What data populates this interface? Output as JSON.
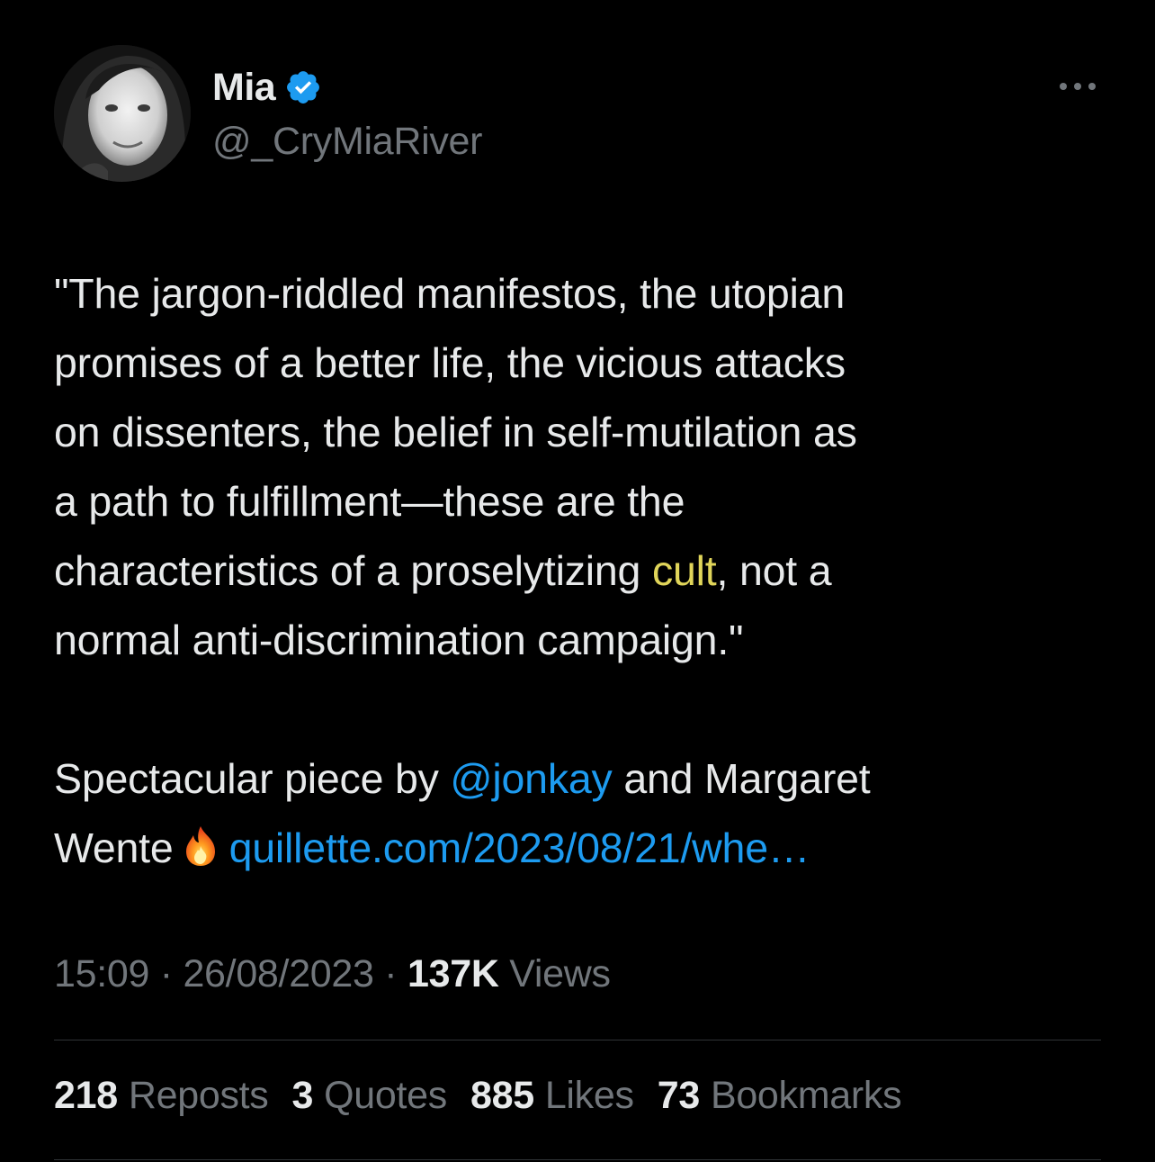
{
  "author": {
    "display_name": "Mia",
    "handle": "@_CryMiaRiver",
    "verified": true,
    "verified_color": "#1d9bf0"
  },
  "tweet": {
    "quote_part1": "\"The jargon-riddled manifestos, the utopian\npromises of a better life, the vicious attacks\non dissenters, the belief in self-mutilation as\na path to fulfillment—these are the\ncharacteristics of a proselytizing ",
    "quote_highlight": "cult",
    "quote_part2": ", not a\nnormal anti-discrimination campaign.\"",
    "line2_prefix": "Spectacular piece by ",
    "mention": "@jonkay",
    "line2_middle": " and Margaret\nWente",
    "emoji_name": "fire-emoji",
    "link_text": "quillette.com/2023/08/21/whe…",
    "highlight_color": "#e0d55a",
    "link_color": "#1d9bf0"
  },
  "meta": {
    "time": "15:09",
    "separator": " · ",
    "date": "26/08/2023",
    "views_count": "137K",
    "views_label": "Views"
  },
  "stats": [
    {
      "count": "218",
      "label": "Reposts"
    },
    {
      "count": "3",
      "label": "Quotes"
    },
    {
      "count": "885",
      "label": "Likes"
    },
    {
      "count": "73",
      "label": "Bookmarks"
    }
  ],
  "icons": {
    "more": "more-horizontal-icon",
    "verified": "verified-badge-icon"
  }
}
